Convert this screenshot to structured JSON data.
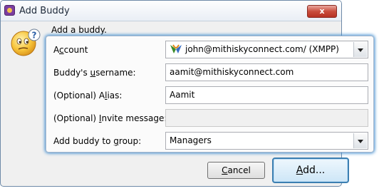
{
  "window": {
    "title": "Add Buddy",
    "close_glyph": "x"
  },
  "prompt": "Add a buddy.",
  "rows": [
    {
      "label_pre": "A",
      "label_u": "c",
      "label_post": "count",
      "value": "john@mithiskyconnect.com/ (XMPP)"
    },
    {
      "label_pre": "Buddy's ",
      "label_u": "u",
      "label_post": "sername:",
      "value": "aamit@mithiskyconnect.com"
    },
    {
      "label_pre": "(Optional) A",
      "label_u": "l",
      "label_post": "ias:",
      "value": "Aamit"
    },
    {
      "label_pre": "(Optional) ",
      "label_u": "I",
      "label_post": "nvite message:",
      "value": ""
    },
    {
      "label_pre": "Add buddy to ",
      "label_u": "g",
      "label_post": "roup:",
      "value": "Managers"
    }
  ],
  "buttons": {
    "cancel_u": "C",
    "cancel_rest": "ancel",
    "add_u": "A",
    "add_rest": "dd..."
  },
  "icons": {
    "app": "pidgin-icon",
    "buddy": "buddy-question-icon",
    "protocol": "xmpp-protocol-icon"
  }
}
